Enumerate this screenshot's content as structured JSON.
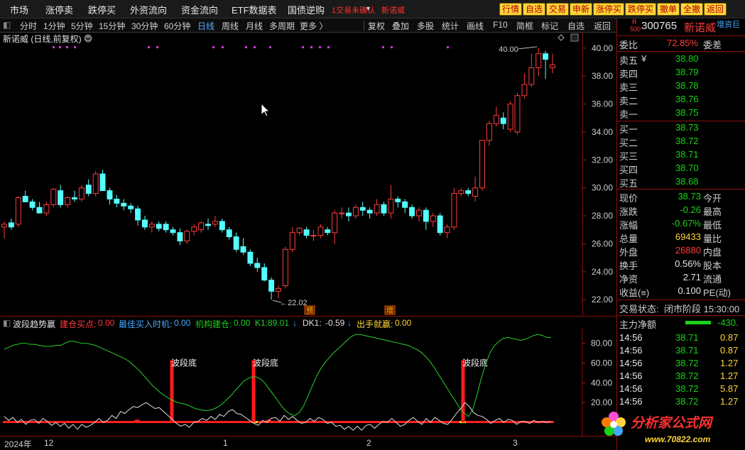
{
  "menu": {
    "items": [
      "市场",
      "涨停卖",
      "跌停买",
      "外资流向",
      "资金流向",
      "ETF数据表",
      "国债逆购"
    ],
    "alert": "1交易未确认",
    "alert_name": "新诺威",
    "toolbar_buttons": [
      "行情",
      "自选",
      "交易",
      "申新",
      "涨停买",
      "跌停买",
      "撤单",
      "全撤",
      "返回"
    ]
  },
  "periods": {
    "items": [
      "分时",
      "1分钟",
      "5分钟",
      "15分钟",
      "30分钟",
      "60分钟",
      "日线",
      "周线",
      "月线",
      "多周期",
      "更多 〉"
    ],
    "active": "日线",
    "tools": [
      "复权",
      "叠加",
      "多股",
      "统计",
      "画线",
      "F10",
      "简框",
      "标记",
      "自选",
      "返回"
    ]
  },
  "chart_title": "新诺威 (日线,前复权)",
  "chart_data": [
    {
      "type": "candlestick",
      "title": "新诺威 (日线,前复权)",
      "ylim": [
        21.4,
        40.6
      ],
      "yticks": [
        22.0,
        24.0,
        26.0,
        28.0,
        30.0,
        32.0,
        34.0,
        36.0,
        38.0,
        40.0
      ],
      "up_color": "#ff3c3c",
      "down_color": "#54ffff",
      "high_label": "40.00",
      "low_label": "22.02",
      "markers": [
        "预",
        "增"
      ],
      "ohlc": [
        [
          27.2,
          27.6,
          26.4,
          27.4
        ],
        [
          27.5,
          27.8,
          27.0,
          27.2
        ],
        [
          27.4,
          29.4,
          27.2,
          29.3
        ],
        [
          29.4,
          29.8,
          29.0,
          29.0
        ],
        [
          29.0,
          29.2,
          28.4,
          28.6
        ],
        [
          28.6,
          29.0,
          28.2,
          28.2
        ],
        [
          28.2,
          29.0,
          28.0,
          28.8
        ],
        [
          28.8,
          30.0,
          28.6,
          29.9
        ],
        [
          29.8,
          30.2,
          28.6,
          28.8
        ],
        [
          28.8,
          29.4,
          28.6,
          29.3
        ],
        [
          29.3,
          29.8,
          29.0,
          29.2
        ],
        [
          29.2,
          30.2,
          29.0,
          30.0
        ],
        [
          30.2,
          30.6,
          29.4,
          29.6
        ],
        [
          29.6,
          31.2,
          29.4,
          31.0
        ],
        [
          31.0,
          31.3,
          29.8,
          29.8
        ],
        [
          29.8,
          30.0,
          28.8,
          29.2
        ],
        [
          29.2,
          29.5,
          28.6,
          28.9
        ],
        [
          28.9,
          29.2,
          28.4,
          28.7
        ],
        [
          28.7,
          28.9,
          28.2,
          28.5
        ],
        [
          28.5,
          28.7,
          27.3,
          27.7
        ],
        [
          27.7,
          28.0,
          27.0,
          27.2
        ],
        [
          27.2,
          27.6,
          26.8,
          27.4
        ],
        [
          27.4,
          27.6,
          26.9,
          27.1
        ],
        [
          27.4,
          27.6,
          26.8,
          27.0
        ],
        [
          27.0,
          27.2,
          26.6,
          26.8
        ],
        [
          26.8,
          27.1,
          25.9,
          26.2
        ],
        [
          26.2,
          27.0,
          26.0,
          26.9
        ],
        [
          26.9,
          27.4,
          26.6,
          27.2
        ],
        [
          27.0,
          27.6,
          26.8,
          27.5
        ],
        [
          27.4,
          27.8,
          27.0,
          27.3
        ],
        [
          27.4,
          28.0,
          27.2,
          27.6
        ],
        [
          27.6,
          27.8,
          26.8,
          27.0
        ],
        [
          27.0,
          27.2,
          26.3,
          26.5
        ],
        [
          26.5,
          26.8,
          25.4,
          25.6
        ],
        [
          25.8,
          26.4,
          25.2,
          25.4
        ],
        [
          25.4,
          25.6,
          24.4,
          24.6
        ],
        [
          24.6,
          25.0,
          24.0,
          24.3
        ],
        [
          24.3,
          24.6,
          23.3,
          23.4
        ],
        [
          23.4,
          23.6,
          22.0,
          22.6
        ],
        [
          22.6,
          23.0,
          22.1,
          22.8
        ],
        [
          23.0,
          25.8,
          22.8,
          25.6
        ],
        [
          25.6,
          27.2,
          25.4,
          26.8
        ],
        [
          26.8,
          27.2,
          26.6,
          27.1
        ],
        [
          27.0,
          27.2,
          26.4,
          26.6
        ],
        [
          26.6,
          27.0,
          26.2,
          26.6
        ],
        [
          26.6,
          27.4,
          26.4,
          27.2
        ],
        [
          27.0,
          27.2,
          26.6,
          26.8
        ],
        [
          26.8,
          28.4,
          26.0,
          28.2
        ],
        [
          28.2,
          28.6,
          27.8,
          28.2
        ],
        [
          28.2,
          28.6,
          27.6,
          28.0
        ],
        [
          28.0,
          28.8,
          27.8,
          28.6
        ],
        [
          28.6,
          29.0,
          28.0,
          28.4
        ],
        [
          28.4,
          28.6,
          27.8,
          28.2
        ],
        [
          28.2,
          29.2,
          28.0,
          28.8
        ],
        [
          28.8,
          29.0,
          28.0,
          28.2
        ],
        [
          28.2,
          30.2,
          27.8,
          29.2
        ],
        [
          29.2,
          29.4,
          28.6,
          29.0
        ],
        [
          29.0,
          29.2,
          28.2,
          28.6
        ],
        [
          28.6,
          28.8,
          27.8,
          28.0
        ],
        [
          28.0,
          28.6,
          27.6,
          28.4
        ],
        [
          28.4,
          28.6,
          27.0,
          27.6
        ],
        [
          27.6,
          28.2,
          27.2,
          28.0
        ],
        [
          28.0,
          28.2,
          26.6,
          26.8
        ],
        [
          26.8,
          27.4,
          26.4,
          27.2
        ],
        [
          27.2,
          30.0,
          27.0,
          29.6
        ],
        [
          29.6,
          30.0,
          29.4,
          29.8
        ],
        [
          29.8,
          30.0,
          29.4,
          29.6
        ],
        [
          29.4,
          30.8,
          29.0,
          30.0
        ],
        [
          30.0,
          33.4,
          29.8,
          33.4
        ],
        [
          33.4,
          34.8,
          33.0,
          34.6
        ],
        [
          34.6,
          35.8,
          34.4,
          35.2
        ],
        [
          35.0,
          35.4,
          34.2,
          34.6
        ],
        [
          34.2,
          36.2,
          34.0,
          36.0
        ],
        [
          34.0,
          36.8,
          33.8,
          36.6
        ],
        [
          36.6,
          38.2,
          36.4,
          37.4
        ],
        [
          37.4,
          39.6,
          37.2,
          38.6
        ],
        [
          38.6,
          40.0,
          38.0,
          39.6
        ],
        [
          39.6,
          39.8,
          37.8,
          39.2
        ],
        [
          38.6,
          39.6,
          38.2,
          38.8
        ]
      ]
    },
    {
      "type": "line",
      "title": "波段趋势赢",
      "ylim": [
        -10,
        92
      ],
      "yticks": [
        20.0,
        40.0,
        60.0,
        80.0
      ],
      "signals": [
        "波段底",
        "波段底",
        "波段底"
      ],
      "series": [
        {
          "name": "K1",
          "color": "#2bcf2b",
          "values": [
            74,
            76,
            78,
            79,
            80,
            80,
            79,
            79,
            78,
            77,
            77,
            77,
            78,
            78,
            80,
            82,
            82,
            81,
            80,
            80,
            79,
            78,
            76,
            74,
            72,
            70,
            68,
            66,
            64,
            61,
            57,
            53,
            48,
            43,
            38,
            34,
            30,
            27,
            24,
            22,
            20,
            19,
            18,
            16,
            14,
            13,
            12,
            12,
            13,
            15,
            18,
            22,
            26,
            31,
            36,
            41,
            44,
            46,
            46,
            44,
            40,
            34,
            28,
            22,
            16,
            11,
            8,
            7,
            10,
            17,
            27,
            37,
            47,
            55,
            61,
            66,
            71,
            75,
            79,
            83,
            87,
            89,
            89,
            88,
            87,
            86,
            85,
            84,
            83,
            82,
            81,
            80,
            79,
            78,
            76,
            74,
            71,
            67,
            62,
            56,
            49,
            42,
            35,
            28,
            21,
            14,
            9,
            6,
            14,
            29,
            46,
            60,
            71,
            78,
            82,
            85,
            86,
            85,
            84,
            83,
            84,
            86,
            88,
            89,
            88,
            86,
            86
          ]
        },
        {
          "name": "DK1",
          "color": "#e0e0e0",
          "values": [
            6,
            2,
            5,
            0,
            3,
            -2,
            2,
            3,
            -1,
            4,
            1,
            -3,
            0,
            -4,
            -1,
            -6,
            -2,
            -7,
            -2,
            -5,
            -3,
            0,
            4,
            0,
            2,
            7,
            4,
            11,
            9,
            13,
            16,
            15,
            18,
            20,
            17,
            14,
            15,
            11,
            7,
            3,
            -1,
            -4,
            -2,
            -5,
            0,
            1,
            4,
            2,
            6,
            3,
            8,
            6,
            11,
            13,
            9,
            8,
            5,
            2,
            -1,
            -3,
            2,
            0,
            4,
            5,
            1,
            7,
            3,
            6,
            2,
            -1,
            0,
            4,
            1,
            5,
            3,
            -1,
            0,
            -4,
            -3,
            -7,
            -4,
            -8,
            -4,
            -8,
            -3,
            -2,
            -6,
            -2,
            1,
            0,
            4,
            0,
            -4,
            -2,
            2,
            5,
            1,
            -2,
            4,
            0,
            5,
            2,
            -1,
            -2,
            3,
            9,
            14,
            20,
            16,
            10,
            7,
            6,
            3,
            -1,
            2,
            4,
            0,
            3,
            2,
            -2,
            1,
            1,
            -1,
            2,
            0,
            1,
            0,
            1
          ]
        }
      ]
    }
  ],
  "indicator": {
    "name": "波段趋势赢",
    "jiancang_label": "建仓买点:",
    "jiancang_value": "0.00",
    "best_label": "最佳买入时机:",
    "best_value": "0.00",
    "jigou_label": "机构建仓:",
    "jigou_value": "0.00",
    "k1_label": "K1:",
    "k1_value": "89.01",
    "dk1_label": "DK1:",
    "dk1_value": "-0.59",
    "out_label": "出手就赢:",
    "out_value": "0.00"
  },
  "time_axis": [
    "2024年",
    "12",
    "1",
    "2",
    "3"
  ],
  "quote": {
    "market": "R",
    "board": "500",
    "code": "300765",
    "name": "新诺威",
    "tag": "增资巨",
    "weibi_label": "委比",
    "weibi_value": "72.85%",
    "weicha_label": "委差",
    "asks": [
      {
        "label": "卖五",
        "mark": "¥",
        "price": "38.80"
      },
      {
        "label": "卖四",
        "mark": "",
        "price": "38.79"
      },
      {
        "label": "卖三",
        "mark": "",
        "price": "38.78"
      },
      {
        "label": "卖二",
        "mark": "",
        "price": "38.76"
      },
      {
        "label": "卖一",
        "mark": "",
        "price": "38.75"
      }
    ],
    "bids": [
      {
        "label": "买一",
        "price": "38.73"
      },
      {
        "label": "买二",
        "price": "38.72"
      },
      {
        "label": "买三",
        "price": "38.71"
      },
      {
        "label": "买四",
        "price": "38.70"
      },
      {
        "label": "买五",
        "price": "38.68"
      }
    ],
    "stats": [
      {
        "l1": "现价",
        "v1": "38.73",
        "c1": "#19d219",
        "l2": "今开"
      },
      {
        "l1": "涨跌",
        "v1": "-0.26",
        "c1": "#19d219",
        "l2": "最高"
      },
      {
        "l1": "涨幅",
        "v1": "-0.67%",
        "c1": "#19d219",
        "l2": "最低"
      },
      {
        "l1": "总量",
        "v1": "69433",
        "c1": "#ffd53b",
        "l2": "量比"
      },
      {
        "l1": "外盘",
        "v1": "26880",
        "c1": "#ff3c3c",
        "l2": "内盘"
      },
      {
        "l1": "换手",
        "v1": "0.56%",
        "c1": "#e6e6e6",
        "l2": "股本"
      },
      {
        "l1": "净资",
        "v1": "2.71",
        "c1": "#e6e6e6",
        "l2": "流通"
      },
      {
        "l1": "收益(≡)",
        "v1": "0.100",
        "c1": "#e6e6e6",
        "l2": "PE(动)"
      }
    ],
    "trade_status_label": "交易状态:",
    "trade_status_value": "闭市阶段 15:30:00",
    "net_label": "主力净额",
    "net_value": "-430.",
    "ticks": [
      {
        "time": "14:56",
        "price": "38.71",
        "vol": "0.87"
      },
      {
        "time": "14:56",
        "price": "38.71",
        "vol": "0.87"
      },
      {
        "time": "14:56",
        "price": "38.72",
        "vol": "1.27"
      },
      {
        "time": "14:56",
        "price": "38.72",
        "vol": "1.27"
      },
      {
        "time": "14:56",
        "price": "38.72",
        "vol": "5.87"
      },
      {
        "time": "14:56",
        "price": "38.72",
        "vol": "1.27"
      }
    ]
  },
  "watermark": {
    "brand": "分析家公式网",
    "url": "www.70822.com"
  }
}
